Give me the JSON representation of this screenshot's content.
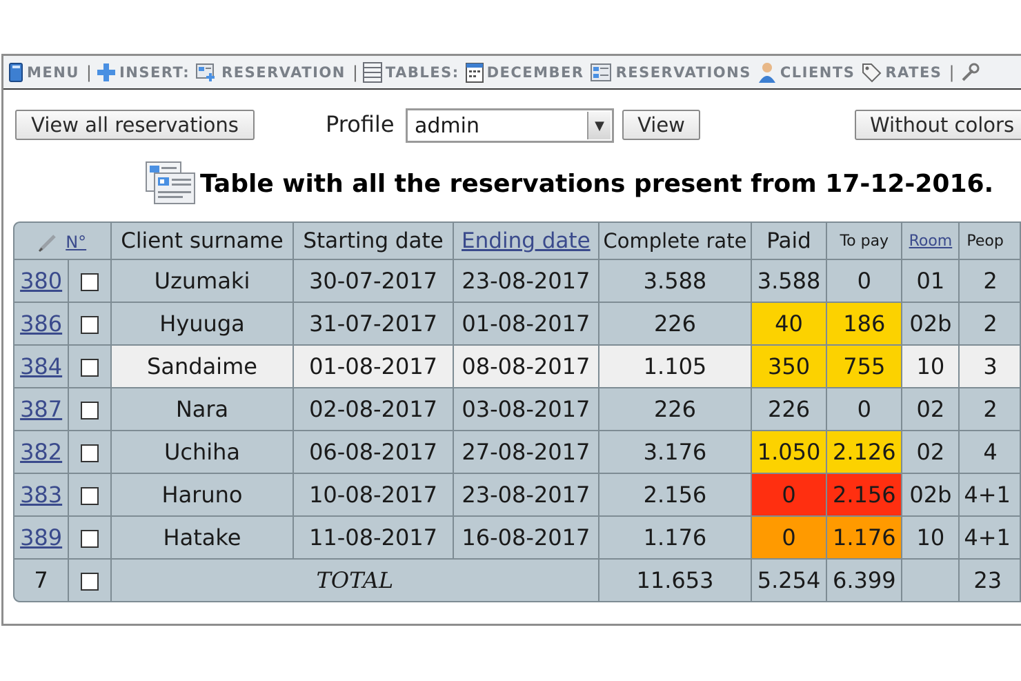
{
  "menu": {
    "menu_label": "MENU",
    "insert_label": "INSERT:",
    "reservation_label": "RESERVATION",
    "tables_label": "TABLES:",
    "december_label": "DECEMBER",
    "reservations_label": "RESERVATIONS",
    "clients_label": "CLIENTS",
    "rates_label": "RATES"
  },
  "controls": {
    "view_all_label": "View all reservations",
    "profile_label": "Profile",
    "profile_value": "admin",
    "view_label": "View",
    "without_colors_label": "Without colors"
  },
  "page_title": "Table with all the reservations present from 17-12-2016.",
  "table": {
    "headers": {
      "number": "N°",
      "client_surname": "Client surname",
      "starting_date": "Starting date",
      "ending_date": "Ending date",
      "complete_rate": "Complete rate",
      "paid": "Paid",
      "to_pay": "To pay",
      "room": "Room",
      "people": "Peop"
    },
    "rows": [
      {
        "id": "380",
        "surname": "Uzumaki",
        "start": "30-07-2017",
        "end": "23-08-2017",
        "rate": "3.588",
        "paid": "3.588",
        "to_pay": "0",
        "room": "01",
        "people": "2"
      },
      {
        "id": "386",
        "surname": "Hyuuga",
        "start": "31-07-2017",
        "end": "01-08-2017",
        "rate": "226",
        "paid": "40",
        "to_pay": "186",
        "room": "02b",
        "people": "2"
      },
      {
        "id": "384",
        "surname": "Sandaime",
        "start": "01-08-2017",
        "end": "08-08-2017",
        "rate": "1.105",
        "paid": "350",
        "to_pay": "755",
        "room": "10",
        "people": "3"
      },
      {
        "id": "387",
        "surname": "Nara",
        "start": "02-08-2017",
        "end": "03-08-2017",
        "rate": "226",
        "paid": "226",
        "to_pay": "0",
        "room": "02",
        "people": "2"
      },
      {
        "id": "382",
        "surname": "Uchiha",
        "start": "06-08-2017",
        "end": "27-08-2017",
        "rate": "3.176",
        "paid": "1.050",
        "to_pay": "2.126",
        "room": "02",
        "people": "4"
      },
      {
        "id": "383",
        "surname": "Haruno",
        "start": "10-08-2017",
        "end": "23-08-2017",
        "rate": "2.156",
        "paid": "0",
        "to_pay": "2.156",
        "room": "02b",
        "people": "4+1"
      },
      {
        "id": "389",
        "surname": "Hatake",
        "start": "11-08-2017",
        "end": "16-08-2017",
        "rate": "1.176",
        "paid": "0",
        "to_pay": "1.176",
        "room": "10",
        "people": "4+1"
      }
    ],
    "total": {
      "count": "7",
      "label": "TOTAL",
      "rate": "11.653",
      "paid": "5.254",
      "to_pay": "6.399",
      "people": "23"
    }
  },
  "colors": {
    "table_bg": "#bccad2",
    "highlight_row": "#efefef",
    "partial_payment": "#fcd200",
    "unpaid_late": "#ff2f10",
    "unpaid": "#ff9a00",
    "link": "#3a4a8c"
  },
  "icons": [
    "menu-book-icon",
    "insert-plus-icon",
    "reservation-form-icon",
    "tables-grid-icon",
    "calendar-icon",
    "reservations-list-icon",
    "client-user-icon",
    "rates-tag-icon",
    "tools-icon",
    "pencil-icon",
    "title-reservations-icon"
  ]
}
